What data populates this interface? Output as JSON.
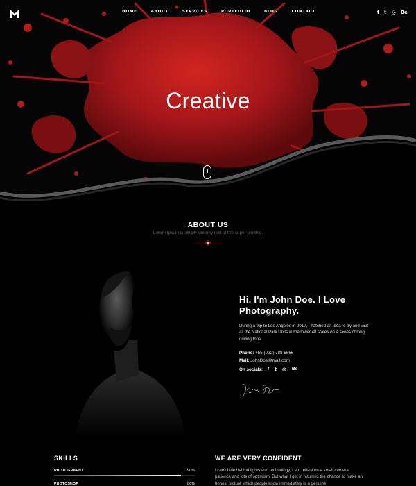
{
  "nav": {
    "logo": "M",
    "items": [
      {
        "label": "HOME"
      },
      {
        "label": "ABOUT"
      },
      {
        "label": "SERVICES"
      },
      {
        "label": "PORTFOLIO"
      },
      {
        "label": "BLOG"
      },
      {
        "label": "CONTACT"
      }
    ],
    "socials": [
      "f",
      "𝕥",
      "◎",
      "Bē"
    ]
  },
  "hero": {
    "title": "Creative",
    "accent_color": "#b3171b"
  },
  "about": {
    "title": "ABOUT US",
    "subtitle": "Lorem Ipsum is simply dummy text of the super printing."
  },
  "bio": {
    "heading": "Hi. I'm John Doe. I Love Photography.",
    "text": "During a trip to Los Angeles in 2017, I hatched an idea to try and visit all the National Park Units in the lower 48 states on a series of long driving trips.",
    "phone_label": "Phone:",
    "phone_value": "+55 (022) 788 6666",
    "mail_label": "Mail:",
    "mail_value": "JohnDoe@mail.com",
    "socials_label": "On socials:",
    "socials": [
      "f",
      "𝕥",
      "◎",
      "Bē"
    ],
    "signature_icon": "signature-handwriting"
  },
  "skills": {
    "title": "SKILLS",
    "items": [
      {
        "name": "PHOTOGRAPHY",
        "percent_label": "90%",
        "level": 0.9
      },
      {
        "name": "PHOTOSHOP",
        "percent_label": "80%",
        "level": 0.8
      }
    ]
  },
  "confident": {
    "title": "WE ARE VERY CONFIDENT",
    "text": "I can't hide behind lights and technology, I am reliant on a small camera, patience and lots of optimism. But what I get in return is the chance to make an honest picture which people know immediately is a genuine"
  }
}
